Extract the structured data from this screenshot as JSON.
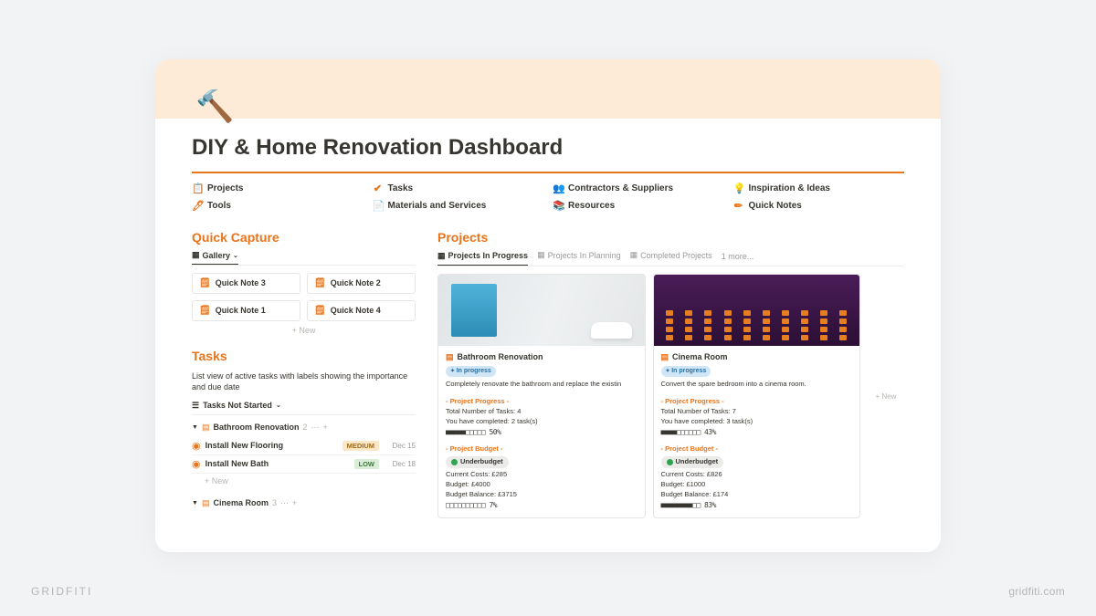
{
  "header": {
    "icon": "🔨",
    "title": "DIY & Home Renovation Dashboard"
  },
  "nav": [
    {
      "icon": "📋",
      "label": "Projects"
    },
    {
      "icon": "✔",
      "label": "Tasks"
    },
    {
      "icon": "👥",
      "label": "Contractors & Suppliers"
    },
    {
      "icon": "💡",
      "label": "Inspiration & Ideas"
    },
    {
      "icon": "🖊",
      "label": "Tools"
    },
    {
      "icon": "📄",
      "label": "Materials and Services"
    },
    {
      "icon": "📚",
      "label": "Resources"
    },
    {
      "icon": "✏",
      "label": "Quick Notes"
    }
  ],
  "captures": {
    "title": "Quick Capture",
    "view_label": "Gallery",
    "notes": [
      "Quick Note 3",
      "Quick Note 2",
      "Quick Note 1",
      "Quick Note 4"
    ],
    "new_label": "+  New"
  },
  "tasks": {
    "title": "Tasks",
    "desc": "List view of active tasks with labels showing the importance and due date",
    "view_label": "Tasks Not Started",
    "groups": [
      {
        "name": "Bathroom Renovation",
        "count": "2",
        "items": [
          {
            "title": "Install New Flooring",
            "tag": "MEDIUM",
            "tag_cls": "med",
            "date": "Dec 15"
          },
          {
            "title": "Install New Bath",
            "tag": "LOW",
            "tag_cls": "low",
            "date": "Dec 18"
          }
        ]
      },
      {
        "name": "Cinema Room",
        "count": "3",
        "items": []
      }
    ],
    "new_label": "+  New"
  },
  "projects": {
    "title": "Projects",
    "tabs": [
      "Projects In Progress",
      "Projects In Planning",
      "Completed Projects"
    ],
    "tabs_more": "1 more...",
    "new_label": "+  New",
    "cards": [
      {
        "title": "Bathroom Renovation",
        "status": "In progress",
        "desc": "Completely renovate the bathroom and replace the existin",
        "progress_header": "- Project Progress -",
        "total_tasks": "Total Number of Tasks: 4",
        "completed": "You have completed: 2 task(s)",
        "progress_bar": "■■■■■□□□□□ 50%",
        "budget_header": "- Project Budget -",
        "budget_status": "Underbudget",
        "cost": "Current Costs: £285",
        "budget": "Budget: £4000",
        "balance": "Budget Balance: £3715",
        "budget_bar": "□□□□□□□□□□ 7%"
      },
      {
        "title": "Cinema Room",
        "status": "In progress",
        "desc": "Convert the spare bedroom into a cinema room.",
        "progress_header": "- Project Progress -",
        "total_tasks": "Total Number of Tasks: 7",
        "completed": "You have completed: 3 task(s)",
        "progress_bar": "■■■■□□□□□□ 43%",
        "budget_header": "- Project Budget -",
        "budget_status": "Underbudget",
        "cost": "Current Costs: £826",
        "budget": "Budget: £1000",
        "balance": "Budget Balance: £174",
        "budget_bar": "■■■■■■■■□□ 83%"
      }
    ]
  },
  "footer": {
    "left": "GRIDFITI",
    "right": "gridfiti.com"
  }
}
